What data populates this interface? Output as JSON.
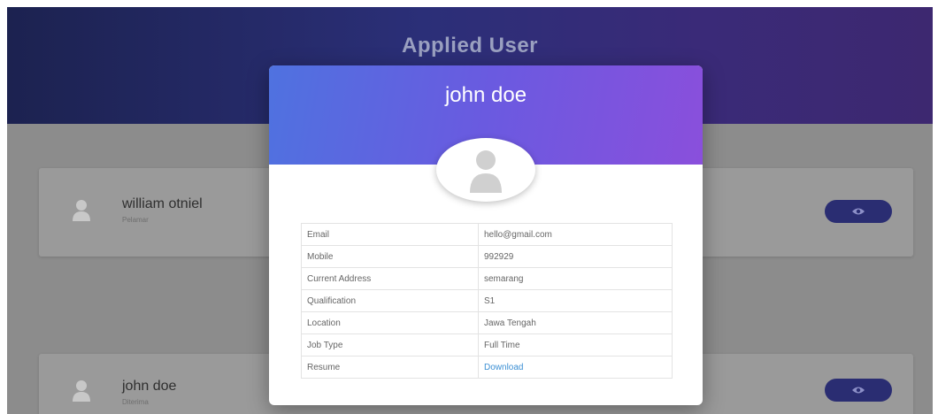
{
  "page": {
    "title": "Applied User"
  },
  "applicants": [
    {
      "name": "william otniel",
      "subtitle": "Pelamar"
    },
    {
      "name": "john doe",
      "subtitle": "Diterima"
    }
  ],
  "modal": {
    "title": "john doe",
    "details": [
      {
        "label": "Email",
        "value": "hello@gmail.com"
      },
      {
        "label": "Mobile",
        "value": "992929"
      },
      {
        "label": "Current Address",
        "value": "semarang"
      },
      {
        "label": "Qualification",
        "value": "S1"
      },
      {
        "label": "Location",
        "value": "Jawa Tengah"
      },
      {
        "label": "Job Type",
        "value": "Full Time"
      },
      {
        "label": "Resume",
        "value": "Download"
      }
    ]
  },
  "colors": {
    "header_dark": "#1c2250",
    "modal_grad_start": "#4f72e0",
    "modal_grad_end": "#8a4fdc",
    "button": "#2a2d72",
    "link": "#3b8fd4"
  }
}
